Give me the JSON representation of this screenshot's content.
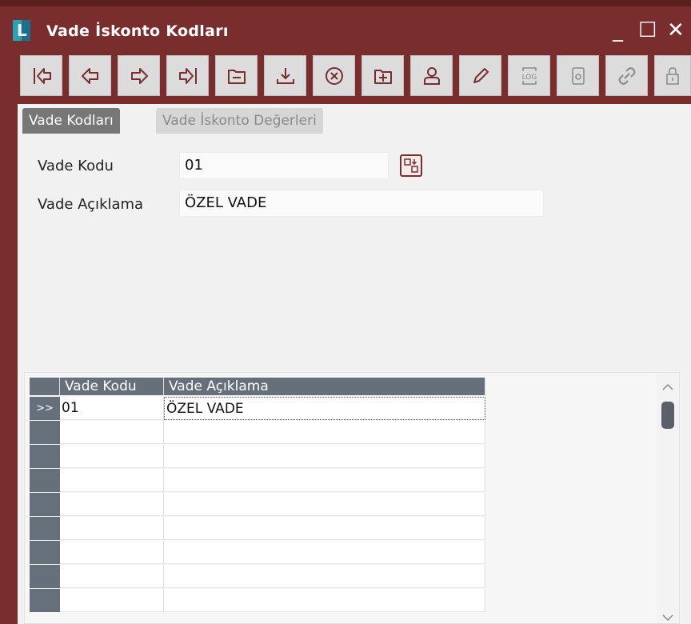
{
  "window": {
    "logo_letter": "L",
    "title": "Vade İskonto Kodları",
    "minimize_label": "_",
    "maximize_label": "☐",
    "close_label": "✕"
  },
  "toolbar": {
    "buttons": [
      "first-record",
      "previous-record",
      "next-record",
      "last-record",
      "folder",
      "save",
      "cancel",
      "new",
      "user",
      "edit",
      "log",
      "document",
      "link",
      "lock"
    ]
  },
  "tabs": [
    {
      "label": "Vade Kodları",
      "active": true
    },
    {
      "label": "Vade İskonto Değerleri",
      "active": false
    }
  ],
  "form": {
    "code_label": "Vade Kodu",
    "code_value": "01",
    "desc_label": "Vade Açıklama",
    "desc_value": "ÖZEL VADE"
  },
  "grid": {
    "columns": [
      "Vade Kodu",
      "Vade Açıklama"
    ],
    "current_marker": ">>",
    "rows": [
      {
        "code": "01",
        "desc": "ÖZEL VADE"
      }
    ]
  },
  "colors": {
    "title_bar": "#7a2d2d",
    "grid_header": "#65707a",
    "active_tab": "#777777"
  }
}
